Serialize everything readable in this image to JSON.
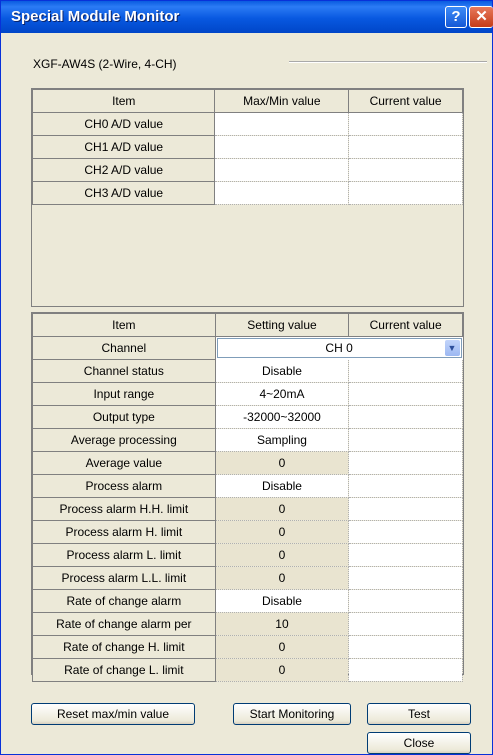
{
  "window": {
    "title": "Special Module Monitor",
    "help_glyph": "?",
    "close_glyph": "✕"
  },
  "module": {
    "label": "XGF-AW4S (2-Wire, 4-CH)"
  },
  "monitor_table": {
    "headers": [
      "Item",
      "Max/Min value",
      "Current value"
    ],
    "rows": [
      {
        "item": "CH0 A/D value",
        "maxmin": "",
        "current": ""
      },
      {
        "item": "CH1 A/D value",
        "maxmin": "",
        "current": ""
      },
      {
        "item": "CH2 A/D value",
        "maxmin": "",
        "current": ""
      },
      {
        "item": "CH3 A/D value",
        "maxmin": "",
        "current": ""
      }
    ]
  },
  "settings_table": {
    "headers": [
      "Item",
      "Setting value",
      "Current value"
    ],
    "channel": {
      "item": "Channel",
      "value": "CH 0"
    },
    "rows": [
      {
        "item": "Channel status",
        "setting": "Disable",
        "current": ""
      },
      {
        "item": "Input range",
        "setting": "4~20mA",
        "current": ""
      },
      {
        "item": "Output type",
        "setting": "-32000~32000",
        "current": ""
      },
      {
        "item": "Average processing",
        "setting": "Sampling",
        "current": ""
      },
      {
        "item": "Average value",
        "setting": "0",
        "current": ""
      },
      {
        "item": "Process alarm",
        "setting": "Disable",
        "current": ""
      },
      {
        "item": "Process alarm H.H. limit",
        "setting": "0",
        "current": ""
      },
      {
        "item": "Process alarm H. limit",
        "setting": "0",
        "current": ""
      },
      {
        "item": "Process alarm L. limit",
        "setting": "0",
        "current": ""
      },
      {
        "item": "Process alarm L.L. limit",
        "setting": "0",
        "current": ""
      },
      {
        "item": "Rate of change alarm",
        "setting": "Disable",
        "current": ""
      },
      {
        "item": "Rate of change alarm per",
        "setting": "10",
        "current": ""
      },
      {
        "item": "Rate of change H. limit",
        "setting": "0",
        "current": ""
      },
      {
        "item": "Rate of change L. limit",
        "setting": "0",
        "current": ""
      }
    ]
  },
  "buttons": {
    "reset": "Reset max/min value",
    "start": "Start Monitoring",
    "test": "Test",
    "close": "Close"
  }
}
